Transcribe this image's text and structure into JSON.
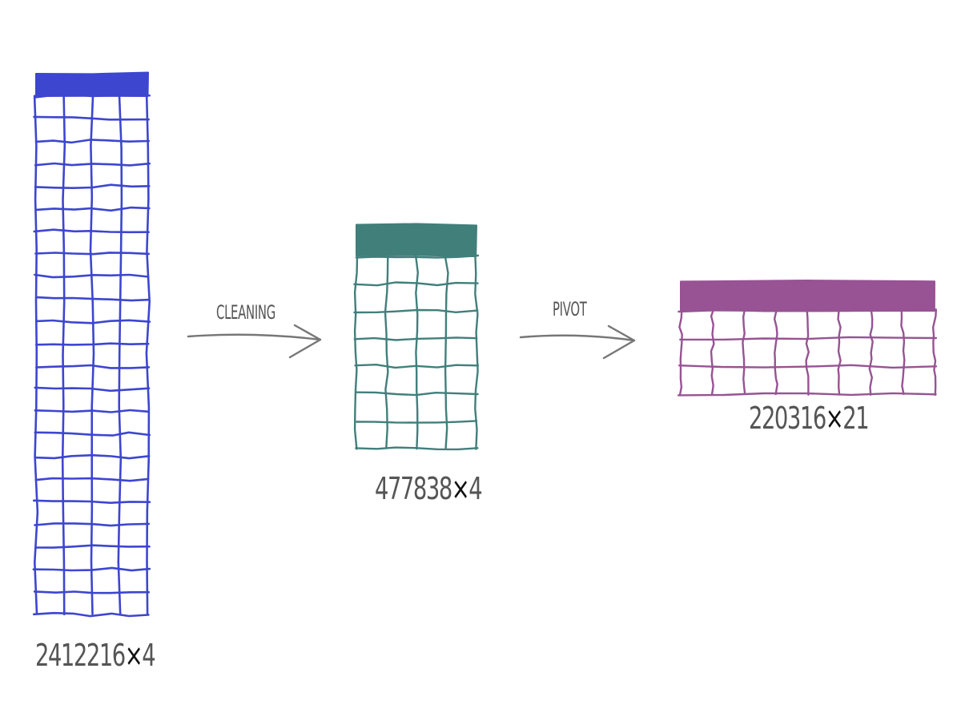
{
  "colors": {
    "raw": "#3d46cf",
    "cleaned": "#417f7b",
    "pivoted": "#975394",
    "arrow": "#777777",
    "label": "#555555"
  },
  "tables": [
    {
      "id": "raw",
      "rows_text": "2412216",
      "times": "×",
      "cols_text": "4",
      "grid_rows": 23,
      "grid_cols": 4,
      "color": "#3d46cf"
    },
    {
      "id": "cleaned",
      "rows_text": "477838",
      "times": "×",
      "cols_text": "4",
      "grid_rows": 7,
      "grid_cols": 4,
      "color": "#417f7b"
    },
    {
      "id": "pivoted",
      "rows_text": "220316",
      "times": "×",
      "cols_text": "21",
      "grid_rows": 3,
      "grid_cols": 8,
      "color": "#975394"
    }
  ],
  "steps": [
    {
      "id": "cleaning",
      "label": "CLEANING"
    },
    {
      "id": "pivot",
      "label": "PIVOT"
    }
  ]
}
